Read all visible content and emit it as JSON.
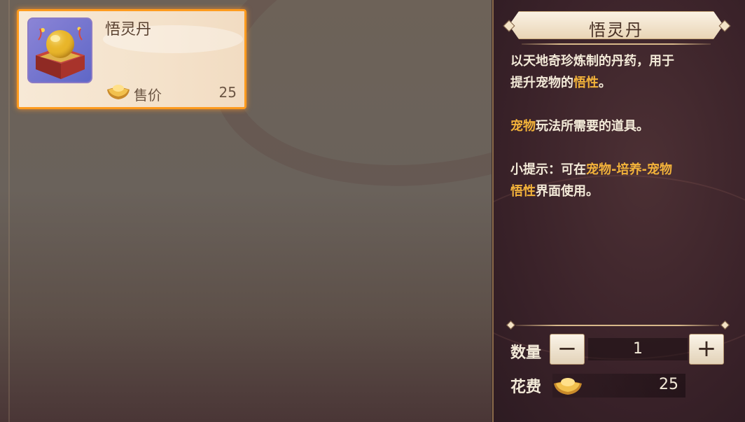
{
  "shop_list": {
    "items": [
      {
        "name": "悟灵丹",
        "price_label": "售价",
        "price": "25",
        "icon": "golden-orb-on-box-icon",
        "currency_icon": "gold-ingot-icon",
        "selected": true
      }
    ]
  },
  "detail": {
    "title": "悟灵丹",
    "description": {
      "line1": "以天地奇珍炼制的丹药，用于",
      "line2_prefix": "提升宠物的",
      "line2_hl": "悟性",
      "line2_suffix": "。",
      "p2_hl": "宠物",
      "p2_suffix": "玩法所需要的道具。",
      "p3_prefix": "小提示：可在",
      "p3_hl": "宠物-培养-宠物",
      "p4_hl": "悟性",
      "p4_suffix": "界面使用。"
    }
  },
  "purchase": {
    "quantity_label": "数量",
    "minus_label": "−",
    "quantity": "1",
    "plus_label": "+",
    "cost_label": "花费",
    "cost": "25",
    "currency_icon": "gold-ingot-icon"
  },
  "colors": {
    "selection_border": "#ff9b1e",
    "highlight": "#f2b23a",
    "text_light": "#f3ead8"
  }
}
